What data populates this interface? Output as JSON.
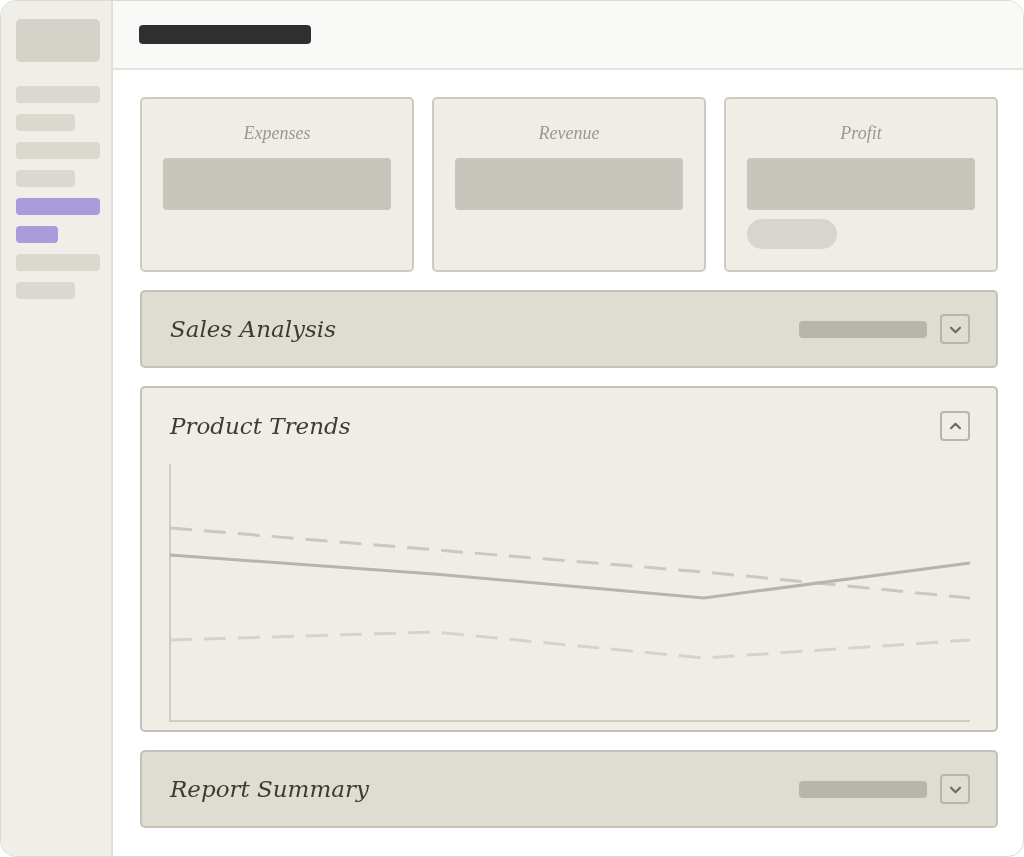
{
  "sidebar": {
    "items": [
      {
        "kind": "long",
        "selected": false
      },
      {
        "kind": "short",
        "selected": false
      },
      {
        "kind": "long",
        "selected": false
      },
      {
        "kind": "short",
        "selected": false
      },
      {
        "kind": "long",
        "selected": true
      },
      {
        "kind": "tiny",
        "selected": true
      },
      {
        "kind": "long",
        "selected": false
      },
      {
        "kind": "short",
        "selected": false
      }
    ]
  },
  "cards": [
    {
      "label": "Expenses",
      "kind": "plain"
    },
    {
      "label": "Revenue",
      "kind": "plain"
    },
    {
      "label": "Profit",
      "kind": "pill"
    }
  ],
  "sections": [
    {
      "title": "Sales Analysis",
      "expanded": false
    },
    {
      "title": "Product Trends",
      "expanded": true
    },
    {
      "title": "Report Summary",
      "expanded": false
    }
  ]
}
